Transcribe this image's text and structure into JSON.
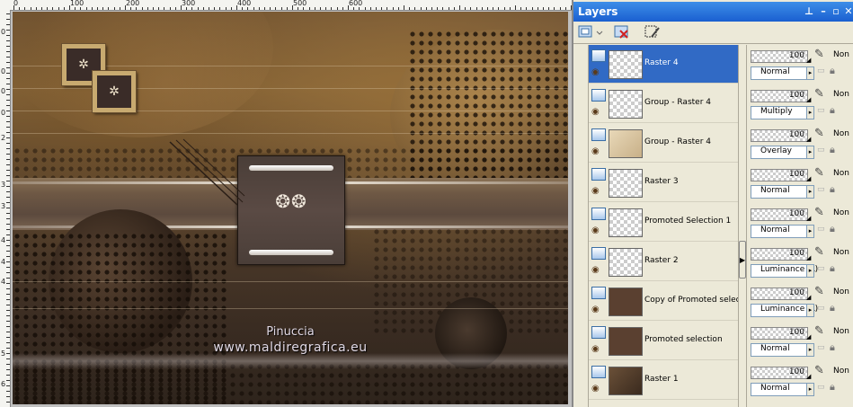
{
  "rulers": {
    "top_labels": [
      "0",
      "100",
      "200",
      "300",
      "400",
      "500",
      "600"
    ],
    "left_labels": [
      "0",
      "0",
      "0",
      "0",
      "2",
      "3",
      "3",
      "4",
      "4",
      "4",
      "5",
      "6"
    ]
  },
  "watermark": {
    "line1": "Pinuccia",
    "line2": "www.maldiregrafica.eu"
  },
  "palette": {
    "title": "Layers",
    "title_buttons": [
      "pin",
      "minimize",
      "restore",
      "close"
    ]
  },
  "layers": [
    {
      "name": "Raster 4",
      "opacity": "100",
      "blend": "Normal",
      "mask": "Non",
      "selected": true
    },
    {
      "name": "Group - Raster 4",
      "opacity": "100",
      "blend": "Multiply",
      "mask": "Non",
      "selected": false
    },
    {
      "name": "Group - Raster 4",
      "opacity": "100",
      "blend": "Overlay",
      "mask": "Non",
      "selected": false
    },
    {
      "name": "Raster 3",
      "opacity": "100",
      "blend": "Normal",
      "mask": "Non",
      "selected": false
    },
    {
      "name": "Promoted Selection 1",
      "opacity": "100",
      "blend": "Normal",
      "mask": "Non",
      "selected": false
    },
    {
      "name": "Raster 2",
      "opacity": "100",
      "blend": "Luminance (L)",
      "mask": "Non",
      "selected": false
    },
    {
      "name": "Copy of Promoted selecti",
      "opacity": "100",
      "blend": "Luminance (L)",
      "mask": "Non",
      "selected": false
    },
    {
      "name": "Promoted selection",
      "opacity": "100",
      "blend": "Normal",
      "mask": "Non",
      "selected": false
    },
    {
      "name": "Raster 1",
      "opacity": "100",
      "blend": "Normal",
      "mask": "Non",
      "selected": false
    }
  ],
  "colors": {
    "selected_row": "#316ac5",
    "titlebar": "#1a5fd0",
    "panel_bg": "#ece9d8"
  }
}
